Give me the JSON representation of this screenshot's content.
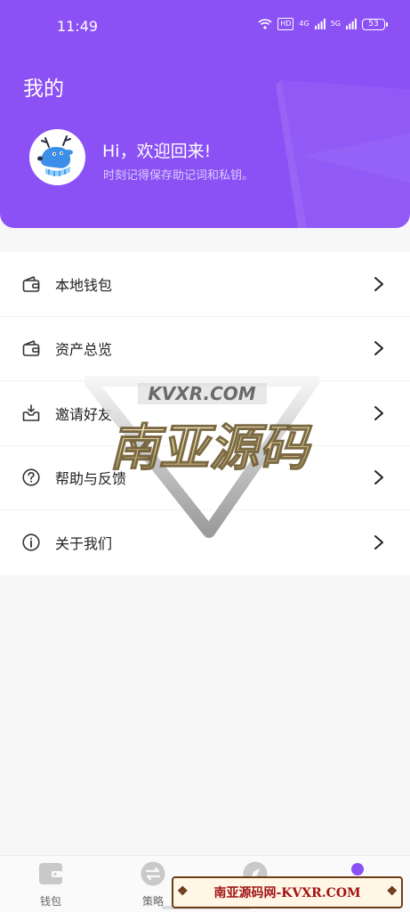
{
  "status_bar": {
    "time": "11:49",
    "hd": "HD",
    "net1": "4G",
    "net2": "5G",
    "battery": "53"
  },
  "header": {
    "title": "我的",
    "greeting": "Hi，欢迎回来!",
    "subtitle": "时刻记得保存助记词和私钥。"
  },
  "menu": {
    "items": [
      {
        "label": "本地钱包",
        "icon": "wallet-icon"
      },
      {
        "label": "资产总览",
        "icon": "wallet-icon"
      },
      {
        "label": "邀请好友",
        "icon": "inbox-icon"
      },
      {
        "label": "帮助与反馈",
        "icon": "help-icon"
      },
      {
        "label": "关于我们",
        "icon": "info-icon"
      }
    ]
  },
  "watermark": {
    "top": "KVXR.COM",
    "main": "南亚源码"
  },
  "tabbar": {
    "tabs": [
      {
        "label": "钱包",
        "icon": "wallet-tab-icon"
      },
      {
        "label": "策略",
        "icon": "swap-tab-icon"
      },
      {
        "label": "",
        "icon": "compass-tab-icon"
      },
      {
        "label": "",
        "icon": "user-tab-icon"
      }
    ],
    "active_color": "#8b51f5"
  },
  "banner": {
    "text": "南亚源码网-KVXR.COM"
  },
  "colors": {
    "brand": "#8b51f5",
    "background": "#f7f7f8"
  }
}
